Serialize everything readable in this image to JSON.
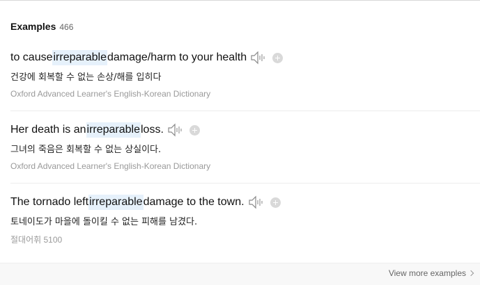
{
  "header": {
    "title": "Examples",
    "count": "466"
  },
  "examples": [
    {
      "pre": "to cause ",
      "highlight": "irreparable",
      "post": " damage/harm to your health",
      "translation": "건강에 회복할 수 없는 손상/해를 입히다",
      "source": "Oxford Advanced Learner's English-Korean Dictionary"
    },
    {
      "pre": "Her death is an ",
      "highlight": "irreparable",
      "post": " loss.",
      "translation": "그녀의 죽음은 회복할 수 없는 상실이다.",
      "source": "Oxford Advanced Learner's English-Korean Dictionary"
    },
    {
      "pre": "The tornado left ",
      "highlight": "irreparable",
      "post": " damage to the town.",
      "translation": "토네이도가 마을에 돌이킬 수 없는 피해를 남겼다.",
      "source": "절대어휘 5100"
    }
  ],
  "footer": {
    "more_label": "View more examples"
  },
  "icons": {
    "audio": "speaker-icon",
    "add": "plus-circle-icon",
    "more": "chevron-right-icon"
  },
  "colors": {
    "highlight": "#e6f1fb"
  }
}
